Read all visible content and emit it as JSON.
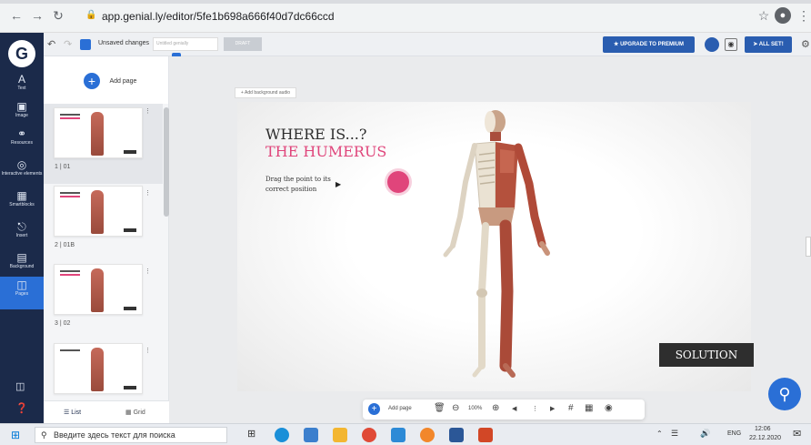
{
  "browser": {
    "url": "app.genial.ly/editor/5fe1b698a666f40d7dc66ccd"
  },
  "editor_toolbar": {
    "status": "Unsaved changes",
    "genially_name": "Untitled genially",
    "draft_label": "DRAFT",
    "upgrade_label": "UPGRADE TO PREMIUM",
    "all_set_label": "ALL SET!"
  },
  "left_nav": {
    "items": [
      {
        "icon": "text-icon",
        "label": "Text"
      },
      {
        "icon": "image-icon",
        "label": "Image"
      },
      {
        "icon": "resources-icon",
        "label": "Resources"
      },
      {
        "icon": "interactive-icon",
        "label": "Interactive elements"
      },
      {
        "icon": "smartblocks-icon",
        "label": "Smartblocks"
      },
      {
        "icon": "insert-icon",
        "label": "Insert"
      },
      {
        "icon": "background-icon",
        "label": "Background"
      },
      {
        "icon": "pages-icon",
        "label": "Pages"
      }
    ]
  },
  "pages_panel": {
    "add_page_label": "Add page",
    "pages": [
      "1 | 01",
      "2 | 01B",
      "3 | 02"
    ],
    "list_label": "List",
    "grid_label": "Grid"
  },
  "slide": {
    "background_audio_label": "Add background audio",
    "title": "WHERE IS...?",
    "subtitle": "THE HUMERUS",
    "instruction": "Drag the point to its correct position",
    "solution_label": "SOLUTION"
  },
  "bottom_toolbar": {
    "add_page_label": "Add page",
    "zoom": "100%"
  },
  "taskbar": {
    "search_placeholder": "Введите здесь текст для поиска",
    "language": "ENG",
    "time": "12:06",
    "date": "22.12.2020"
  },
  "colors": {
    "accent_pink": "#e0457b",
    "brand_blue": "#2a6fd6",
    "nav_dark": "#1b2a4a"
  }
}
